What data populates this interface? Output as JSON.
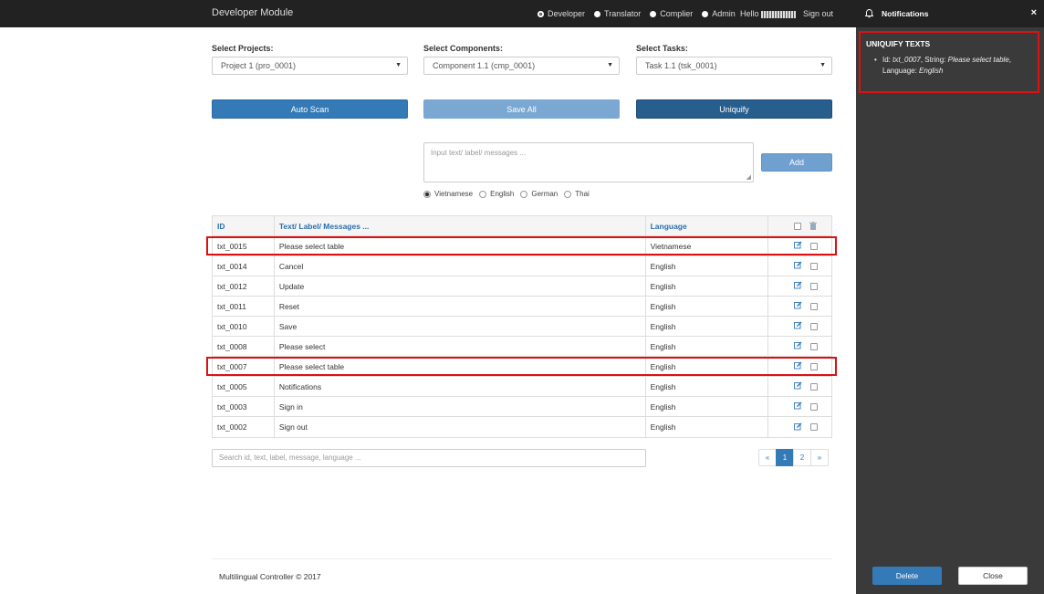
{
  "header": {
    "title": "Developer Module",
    "roles": [
      {
        "label": "Developer",
        "selected": true
      },
      {
        "label": "Translator",
        "selected": false
      },
      {
        "label": "Complier",
        "selected": false
      },
      {
        "label": "Admin",
        "selected": false
      }
    ],
    "hello": "Hello",
    "signout": "Sign out"
  },
  "selects": {
    "projects": {
      "label": "Select Projects:",
      "value": "Project 1 (pro_0001)"
    },
    "components": {
      "label": "Select Components:",
      "value": "Component 1.1 (cmp_0001)"
    },
    "tasks": {
      "label": "Select Tasks:",
      "value": "Task 1.1 (tsk_0001)"
    }
  },
  "buttons": {
    "autoscan": "Auto Scan",
    "saveall": "Save All",
    "uniquify": "Uniquify",
    "add": "Add"
  },
  "input": {
    "placeholder": "Input text/ label/ messages ..."
  },
  "languages": [
    {
      "label": "Vietnamese",
      "selected": true
    },
    {
      "label": "English",
      "selected": false
    },
    {
      "label": "German",
      "selected": false
    },
    {
      "label": "Thai",
      "selected": false
    }
  ],
  "table": {
    "headers": {
      "id": "ID",
      "text": "Text/ Label/ Messages ...",
      "language": "Language"
    },
    "rows": [
      {
        "id": "txt_0015",
        "text": "Please select table",
        "language": "Vietnamese"
      },
      {
        "id": "txt_0014",
        "text": "Cancel",
        "language": "English"
      },
      {
        "id": "txt_0012",
        "text": "Update",
        "language": "English"
      },
      {
        "id": "txt_0011",
        "text": "Reset",
        "language": "English"
      },
      {
        "id": "txt_0010",
        "text": "Save",
        "language": "English"
      },
      {
        "id": "txt_0008",
        "text": "Please select",
        "language": "English"
      },
      {
        "id": "txt_0007",
        "text": "Please select table",
        "language": "English"
      },
      {
        "id": "txt_0005",
        "text": "Notifications",
        "language": "English"
      },
      {
        "id": "txt_0003",
        "text": "Sign in",
        "language": "English"
      },
      {
        "id": "txt_0002",
        "text": "Sign out",
        "language": "English"
      }
    ]
  },
  "search": {
    "placeholder": "Search id, text, label, message, language ..."
  },
  "pagination": {
    "prev": "«",
    "pages": [
      "1",
      "2"
    ],
    "current": "1",
    "next": "»"
  },
  "footer": "Multilingual Controller © 2017",
  "panel": {
    "title": "Notifications",
    "close": "×",
    "notice_title": "UNIQUIFY TEXTS",
    "notice": {
      "id_label": "Id: ",
      "id_value": "txt_0007",
      "string_label": ", String: ",
      "string_value": "Please select table",
      "lang_label": ", Language: ",
      "lang_value": "English"
    },
    "delete": "Delete",
    "close_button": "Close"
  },
  "colors": {
    "primary": "#337ab7",
    "highlight": "#dd1111",
    "panel_bg": "#3a3a3a",
    "topbar_bg": "#222222"
  }
}
